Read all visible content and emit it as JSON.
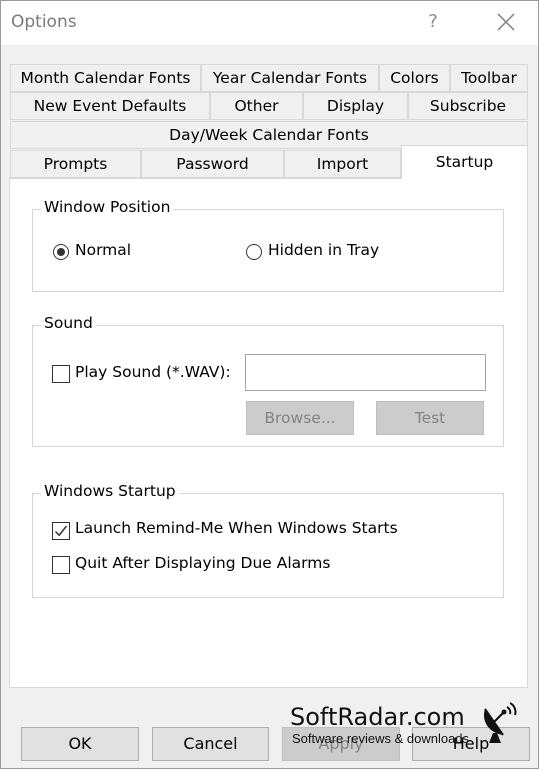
{
  "window": {
    "title": "Options",
    "help_glyph": "?"
  },
  "tabs": {
    "row1": [
      "Month Calendar Fonts",
      "Year Calendar Fonts",
      "Colors",
      "Toolbar"
    ],
    "row2": [
      "New Event Defaults",
      "Other",
      "Display",
      "Subscribe"
    ],
    "row3": [
      "Day/Week Calendar Fonts"
    ],
    "row4": [
      "Prompts",
      "Password",
      "Import",
      "Startup"
    ],
    "active": "Startup"
  },
  "window_position": {
    "title": "Window Position",
    "normal_label": "Normal",
    "normal_selected": true,
    "hidden_label": "Hidden in Tray",
    "hidden_selected": false
  },
  "sound": {
    "title": "Sound",
    "play_label": "Play Sound (*.WAV):",
    "play_checked": false,
    "file_value": "",
    "browse_label": "Browse...",
    "test_label": "Test"
  },
  "startup": {
    "title": "Windows Startup",
    "launch_label": "Launch Remind-Me When Windows Starts",
    "launch_checked": true,
    "quit_label": "Quit After Displaying Due Alarms",
    "quit_checked": false
  },
  "buttons": {
    "ok": "OK",
    "cancel": "Cancel",
    "apply": "Apply",
    "help": "Help"
  },
  "watermark": {
    "title": "SoftRadar.com",
    "subtitle": "Software reviews & downloads"
  },
  "colors": {
    "panel_bg": "#ffffff",
    "dialog_bg": "#f0f0f0",
    "disabled_button": "#cccccc"
  },
  "icons": {
    "close": "close-icon",
    "check": "checkmark-icon",
    "satellite": "satellite-dish-icon"
  }
}
